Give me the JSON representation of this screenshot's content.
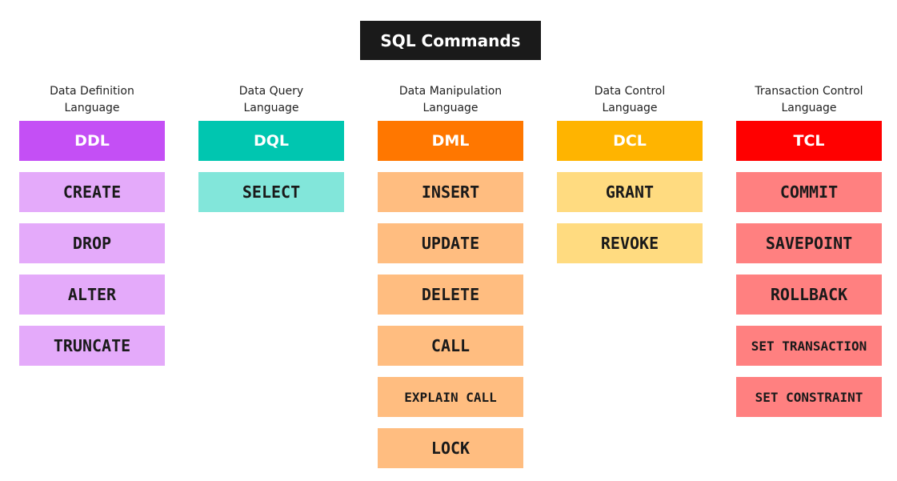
{
  "title": "SQL Commands",
  "columns": [
    {
      "caption": [
        "Data Definition",
        "Language"
      ],
      "header": "DDL",
      "header_color": "#c44ff5",
      "cmd_color": "#e4aafa",
      "commands": [
        "CREATE",
        "DROP",
        "ALTER",
        "TRUNCATE"
      ]
    },
    {
      "caption": [
        "Data Query",
        "Language"
      ],
      "header": "DQL",
      "header_color": "#00c6b0",
      "cmd_color": "#82e6da",
      "commands": [
        "SELECT"
      ]
    },
    {
      "caption": [
        "Data Manipulation",
        "Language"
      ],
      "header": "DML",
      "header_color": "#ff7700",
      "cmd_color": "#ffbd80",
      "commands": [
        "INSERT",
        "UPDATE",
        "DELETE",
        "CALL",
        "EXPLAIN CALL",
        "LOCK"
      ]
    },
    {
      "caption": [
        "Data Control",
        "Language"
      ],
      "header": "DCL",
      "header_color": "#ffb400",
      "cmd_color": "#ffdb80",
      "commands": [
        "GRANT",
        "REVOKE"
      ]
    },
    {
      "caption": [
        "Transaction Control",
        "Language"
      ],
      "header": "TCL",
      "header_color": "#ff0000",
      "cmd_color": "#ff8080",
      "commands": [
        "COMMIT",
        "SAVEPOINT",
        "ROLLBACK",
        "SET TRANSACTION",
        "SET CONSTRAINT"
      ]
    }
  ]
}
